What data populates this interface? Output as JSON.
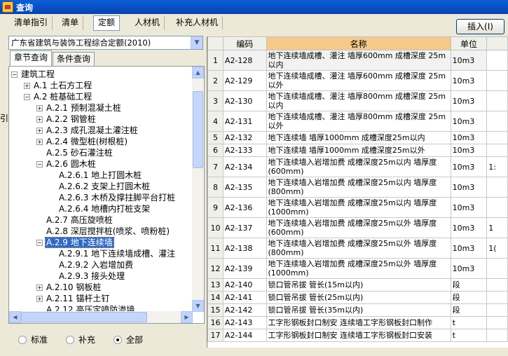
{
  "window": {
    "title": "查询"
  },
  "tabs": [
    {
      "label": "清单指引"
    },
    {
      "label": "清单"
    },
    {
      "label": "定额"
    },
    {
      "label": "人材机"
    },
    {
      "label": "补充人材机"
    }
  ],
  "insert_button": "插入(I)",
  "combo": {
    "value": "广东省建筑与装饰工程综合定额(2010)"
  },
  "subtabs": [
    {
      "label": "章节查询"
    },
    {
      "label": "条件查询"
    }
  ],
  "tree": [
    {
      "label": "建筑工程",
      "expander": "−"
    },
    {
      "label": "A.1  土石方工程",
      "expander": "+"
    },
    {
      "label": "A.2  桩基础工程",
      "expander": "−"
    },
    {
      "label": "A.2.1  预制混凝土桩",
      "expander": "+"
    },
    {
      "label": "A.2.2  钢管桩",
      "expander": "+"
    },
    {
      "label": "A.2.3  成孔混凝土灌注桩",
      "expander": "+"
    },
    {
      "label": "A.2.4  微型桩(树根桩)",
      "expander": "+"
    },
    {
      "label": "A.2.5  砂石灌注桩",
      "expander": ""
    },
    {
      "label": "A.2.6  圆木桩",
      "expander": "−"
    },
    {
      "label": "A.2.6.1  地上打圆木桩",
      "expander": ""
    },
    {
      "label": "A.2.6.2  支架上打圆木桩",
      "expander": ""
    },
    {
      "label": "A.2.6.3  木桥及撑拄脚平台打桩",
      "expander": ""
    },
    {
      "label": "A.2.6.4  地槽内打桩支架",
      "expander": ""
    },
    {
      "label": "A.2.7  高压旋喷桩",
      "expander": ""
    },
    {
      "label": "A.2.8  深层搅拌桩(喷浆、喷粉桩)",
      "expander": ""
    },
    {
      "label": "A.2.9  地下连续墙",
      "expander": "−"
    },
    {
      "label": "A.2.9.1  地下连续墙成槽、灌注",
      "expander": ""
    },
    {
      "label": "A.2.9.2  入岩增加费",
      "expander": ""
    },
    {
      "label": "A.2.9.3  接头处理",
      "expander": ""
    },
    {
      "label": "A.2.10  钢板桩",
      "expander": "+"
    },
    {
      "label": "A.2.11  锚杆土钉",
      "expander": "+"
    },
    {
      "label": "A.2.12  高压定喷防渗墙",
      "expander": ""
    }
  ],
  "radios": [
    {
      "label": "标准",
      "checked": false
    },
    {
      "label": "补充",
      "checked": false
    },
    {
      "label": "全部",
      "checked": true
    }
  ],
  "grid": {
    "headers": {
      "code": "编码",
      "name": "名称",
      "unit": "单位"
    },
    "rows": [
      {
        "n": "1",
        "code": "A2-128",
        "name": "地下连续墙成槽、灌注 墙厚600mm 成槽深度 25m以内",
        "unit": "10m3",
        "extra": ""
      },
      {
        "n": "2",
        "code": "A2-129",
        "name": "地下连续墙成槽、灌注 墙厚600mm 成槽深度 25m以外",
        "unit": "10m3",
        "extra": ""
      },
      {
        "n": "3",
        "code": "A2-130",
        "name": "地下连续墙成槽、灌注 墙厚800mm 成槽深度 25m以内",
        "unit": "10m3",
        "extra": ""
      },
      {
        "n": "4",
        "code": "A2-131",
        "name": "地下连续墙成槽、灌注 墙厚800mm 成槽深度 25m以外",
        "unit": "10m3",
        "extra": ""
      },
      {
        "n": "5",
        "code": "A2-132",
        "name": "地下连续墙 墙厚1000mm 成槽深度25m以内",
        "unit": "10m3",
        "extra": ""
      },
      {
        "n": "6",
        "code": "A2-133",
        "name": "地下连续墙 墙厚1000mm 成槽深度25m以外",
        "unit": "10m3",
        "extra": ""
      },
      {
        "n": "7",
        "code": "A2-134",
        "name": "地下连续墙入岩增加费 成槽深度25m以内 墙厚度(600mm)",
        "unit": "10m3",
        "extra": "1:"
      },
      {
        "n": "8",
        "code": "A2-135",
        "name": "地下连续墙入岩增加费 成槽深度25m以内 墙厚度(800mm)",
        "unit": "10m3",
        "extra": ""
      },
      {
        "n": "9",
        "code": "A2-136",
        "name": "地下连续墙入岩增加费 成槽深度25m以内 墙厚度(1000mm)",
        "unit": "10m3",
        "extra": ""
      },
      {
        "n": "10",
        "code": "A2-137",
        "name": "地下连续墙入岩增加费 成槽深度25m以外 墙厚度(600mm)",
        "unit": "10m3",
        "extra": "1"
      },
      {
        "n": "11",
        "code": "A2-138",
        "name": "地下连续墙入岩增加费 成槽深度25m以外 墙厚度(800mm)",
        "unit": "10m3",
        "extra": "1("
      },
      {
        "n": "12",
        "code": "A2-139",
        "name": "地下连续墙入岩增加费 成槽深度25m以外 墙厚度(1000mm)",
        "unit": "10m3",
        "extra": ""
      },
      {
        "n": "13",
        "code": "A2-140",
        "name": "锁口管吊拔 管长(15m以内)",
        "unit": "段",
        "extra": ""
      },
      {
        "n": "14",
        "code": "A2-141",
        "name": "锁口管吊拔 管长(25m以内)",
        "unit": "段",
        "extra": ""
      },
      {
        "n": "15",
        "code": "A2-142",
        "name": "锁口管吊拔 管长(35m以内)",
        "unit": "段",
        "extra": ""
      },
      {
        "n": "16",
        "code": "A2-143",
        "name": "工字形钢板封口制安 连续墙工字形钢板封口制作",
        "unit": "t",
        "extra": ""
      },
      {
        "n": "17",
        "code": "A2-144",
        "name": "工字形钢板封口制安 连续墙工字形钢板封口安装",
        "unit": "t",
        "extra": ""
      }
    ]
  },
  "left_edge_char": "引"
}
